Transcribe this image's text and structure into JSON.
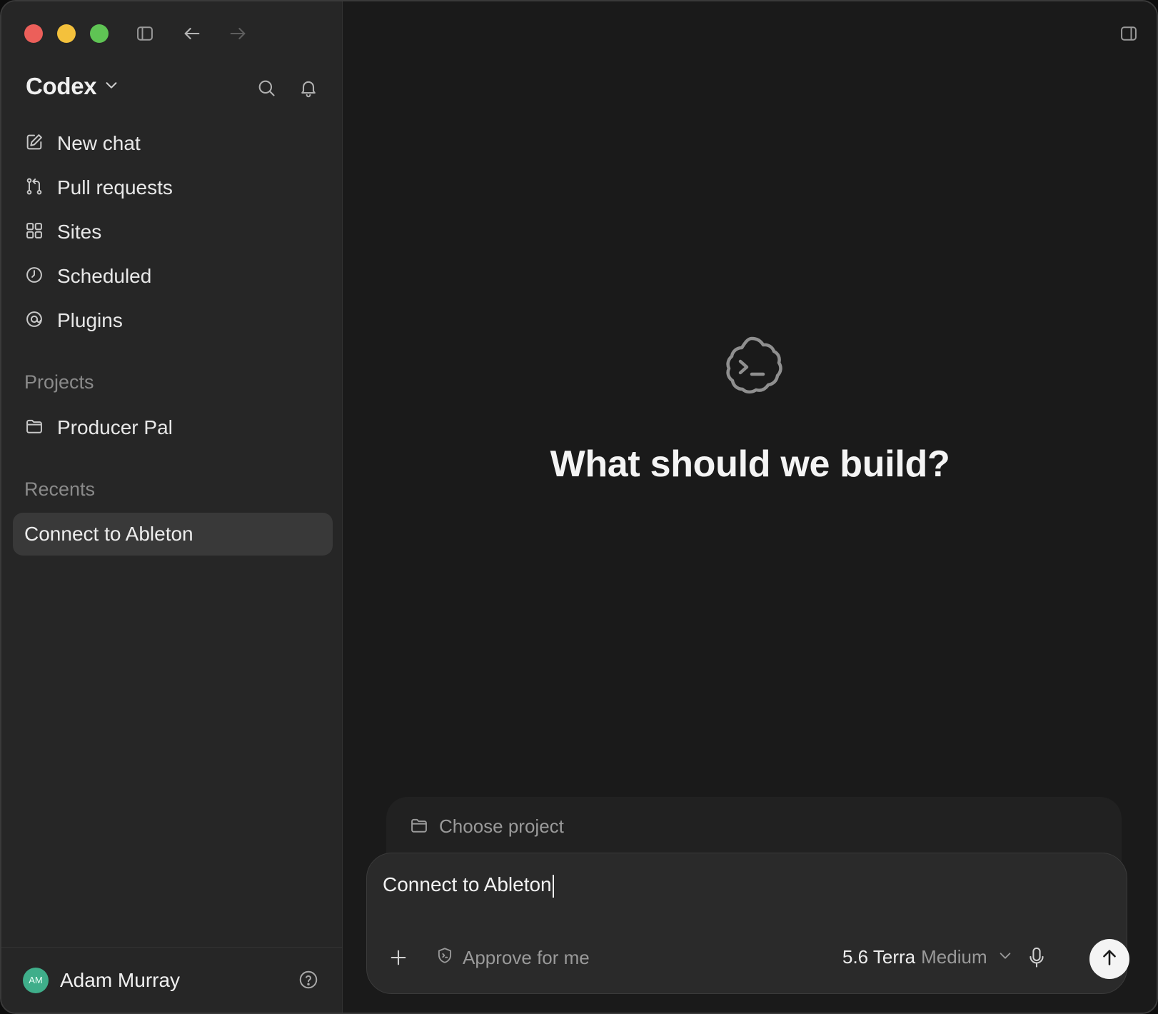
{
  "sidebar": {
    "brand": "Codex",
    "nav": [
      {
        "label": "New chat",
        "icon": "compose-icon"
      },
      {
        "label": "Pull requests",
        "icon": "pull-request-icon"
      },
      {
        "label": "Sites",
        "icon": "grid-icon"
      },
      {
        "label": "Scheduled",
        "icon": "clock-icon"
      },
      {
        "label": "Plugins",
        "icon": "plugin-icon"
      }
    ],
    "projects_title": "Projects",
    "projects": [
      {
        "label": "Producer Pal",
        "icon": "folder-icon"
      }
    ],
    "recents_title": "Recents",
    "recents": [
      {
        "label": "Connect to Ableton"
      }
    ],
    "user": {
      "initials": "AM",
      "name": "Adam Murray"
    }
  },
  "main": {
    "headline": "What should we build?",
    "choose_project": "Choose project",
    "composer": {
      "value": "Connect to Ableton",
      "approve_label": "Approve for me",
      "model_name": "5.6 Terra",
      "model_effort": "Medium"
    }
  },
  "colors": {
    "sidebar_bg": "#262626",
    "main_bg": "#1a1a1a",
    "recent_selected_bg": "#393939",
    "traffic_red": "#ec5f5a",
    "traffic_yellow": "#f4c13c",
    "traffic_green": "#5fc454",
    "avatar_bg": "#3fae8a"
  }
}
